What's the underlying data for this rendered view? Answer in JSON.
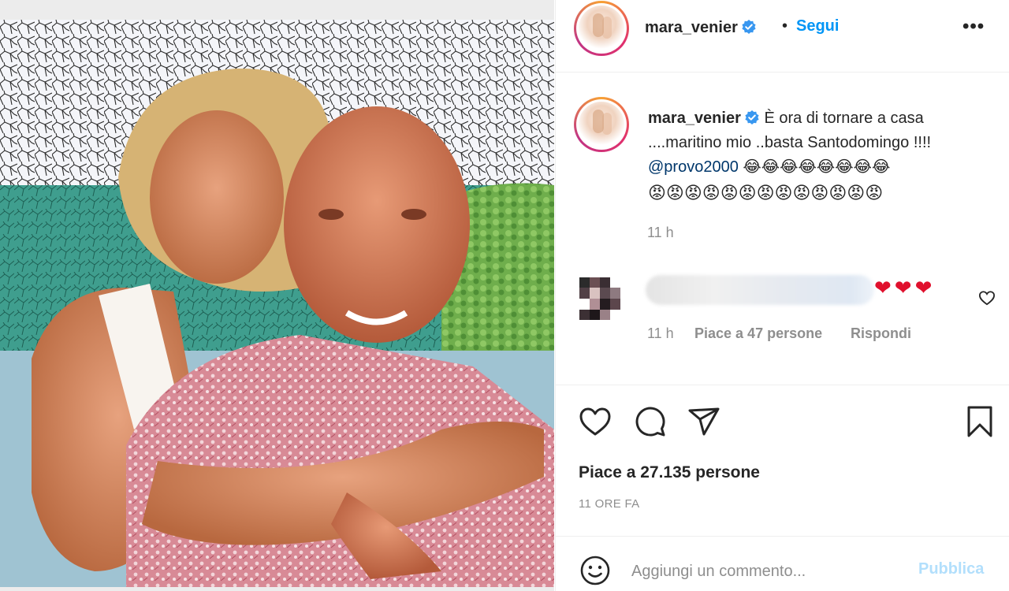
{
  "post": {
    "author": "mara_venier",
    "follow_label": "Segui",
    "separator": "•",
    "more_label": "•••",
    "photo_alt": "Foto: coppia abbracciata al tramonto"
  },
  "caption": {
    "username": "mara_venier",
    "line1": "È ora di tornare a casa",
    "line2": "....maritino mio ..basta Santodomingo !!!!",
    "mention": "@provo2000",
    "emoji_laugh": "😂😂😂😂😂😂😂😂",
    "emoji_angry": "😡😡😡😡😡😡😡😡😡😡😡😡😡",
    "time": "11 h"
  },
  "comment": {
    "hearts": "❤❤❤",
    "time": "11 h",
    "likes": "Piace a 47 persone",
    "reply": "Rispondi"
  },
  "actions": {
    "like_icon": "heart-icon",
    "comment_icon": "comment-bubble-icon",
    "share_icon": "paper-plane-icon",
    "save_icon": "bookmark-icon"
  },
  "stats": {
    "likes": "Piace a 27.135 persone",
    "time": "11 ORE FA"
  },
  "composer": {
    "placeholder": "Aggiungi un commento...",
    "publish": "Pubblica"
  },
  "colors": {
    "accent": "#0095f6",
    "text": "#262626",
    "muted": "#8e8e8e",
    "publish_disabled": "#b2dffc",
    "heart": "#e0102d"
  }
}
